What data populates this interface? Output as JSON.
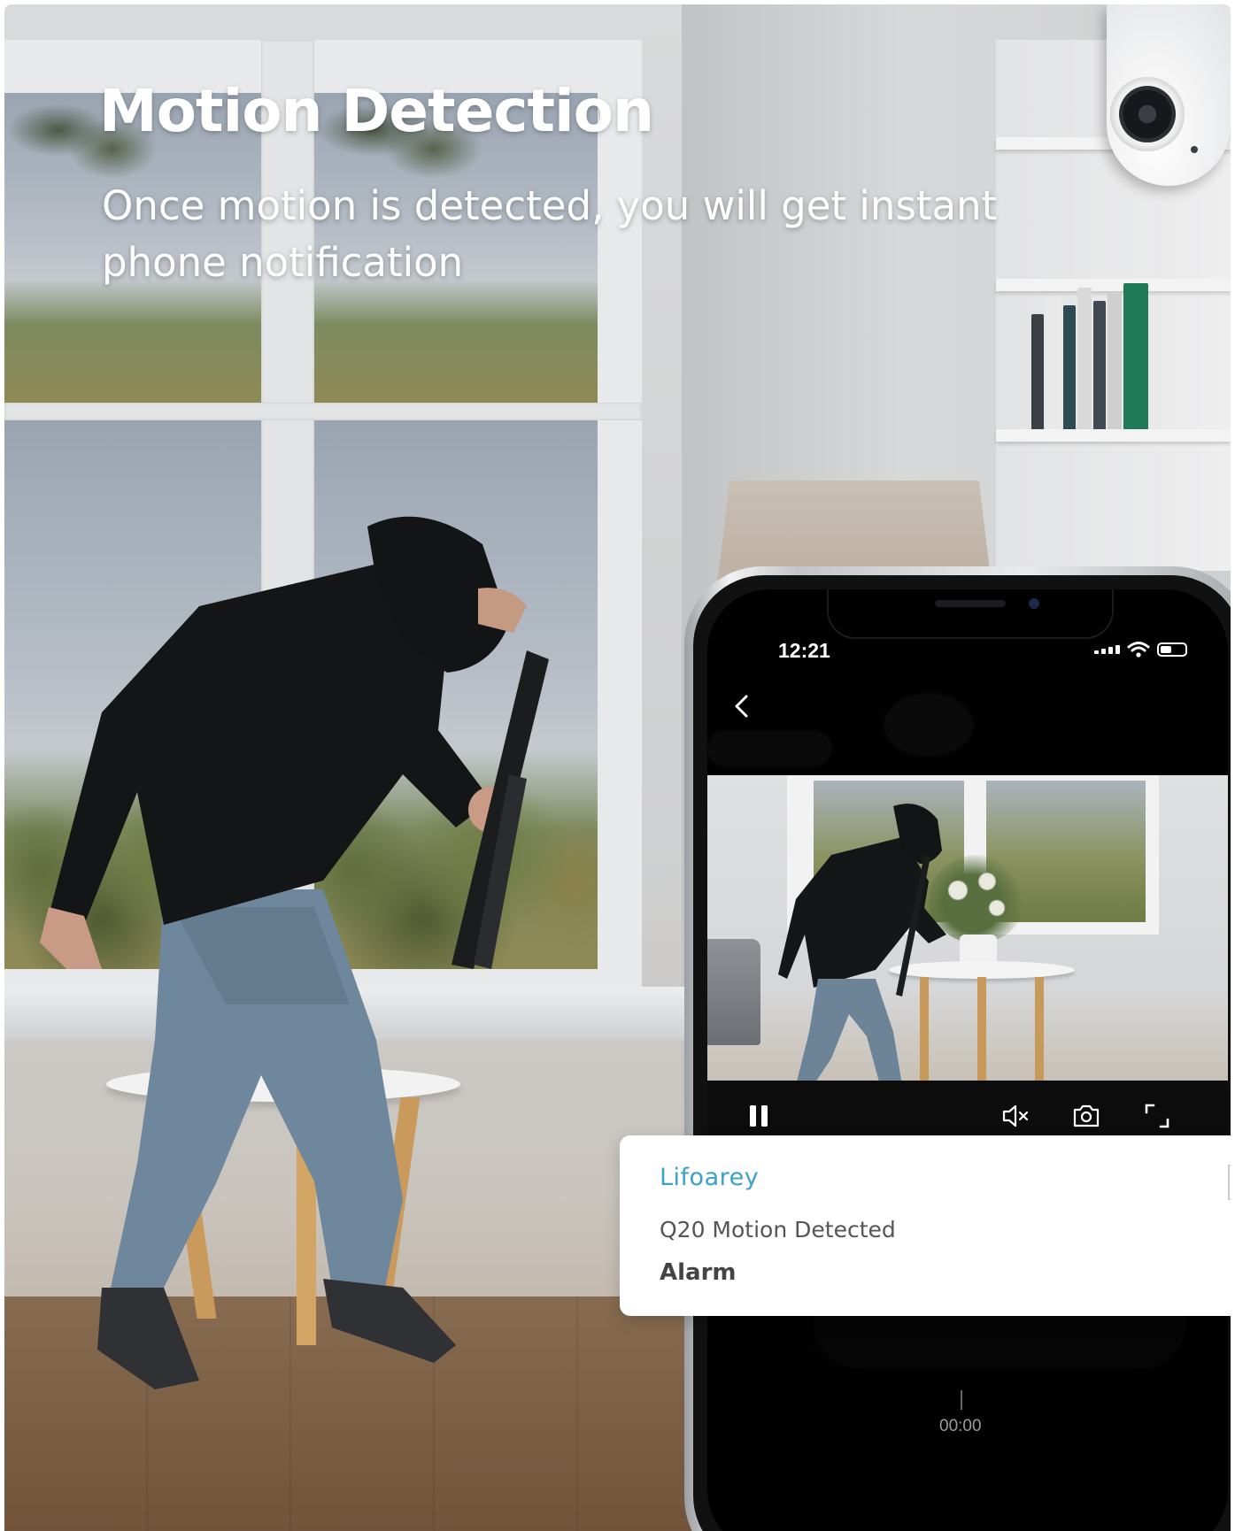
{
  "hero": {
    "title": "Motion Detection",
    "subtitle": "Once motion is detected, you will get instant phone notification"
  },
  "phone": {
    "status_time": "12:21",
    "icons": [
      "back-chevron-icon",
      "wifi-icon",
      "battery-icon",
      "signal-dots-icon"
    ],
    "controls": [
      "pause-icon",
      "mute-icon",
      "snapshot-icon",
      "fullscreen-icon"
    ],
    "playback_time": "00:00"
  },
  "notification": {
    "brand": "Lifoarey",
    "title": "Q20 Motion Detected",
    "body": "Alarm"
  },
  "colors": {
    "brand_accent": "#3aa1c9",
    "headline_text": "#ffffff",
    "phone_screen": "#000000"
  }
}
